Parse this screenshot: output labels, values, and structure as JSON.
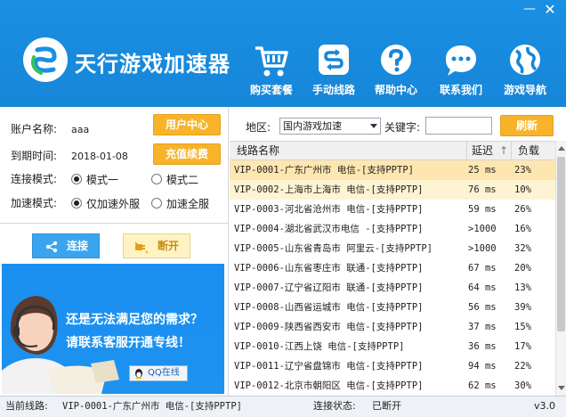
{
  "app": {
    "title": "天行游戏加速器",
    "window_controls": {
      "minimize": "—",
      "close": "✕"
    }
  },
  "nav": [
    {
      "label": "购买套餐",
      "icon": "shopping-cart-icon"
    },
    {
      "label": "手动线路",
      "icon": "route-icon"
    },
    {
      "label": "帮助中心",
      "icon": "help-icon"
    },
    {
      "label": "联系我们",
      "icon": "chat-icon"
    },
    {
      "label": "游戏导航",
      "icon": "globe-icon"
    }
  ],
  "account": {
    "username_label": "账户名称:",
    "username": "aaa",
    "expiry_label": "到期时间:",
    "expiry": "2018-01-08",
    "user_center_btn": "用户中心",
    "recharge_btn": "充值续费"
  },
  "modes": {
    "connect_label": "连接模式:",
    "connect_options": [
      "模式一",
      "模式二"
    ],
    "connect_selected": 0,
    "accel_label": "加速模式:",
    "accel_options": [
      "仅加速外服",
      "加速全服"
    ],
    "accel_selected": 0
  },
  "actions": {
    "connect": "连接",
    "disconnect": "断开"
  },
  "banner": {
    "line1": "还是无法满足您的需求？",
    "line2": "请联系客服开通专线！",
    "qq_button": "QQ在线"
  },
  "filter": {
    "region_label": "地区:",
    "region_value": "国内游戏加速",
    "keyword_label": "关键字:",
    "keyword_value": "",
    "refresh_btn": "刷新"
  },
  "table": {
    "columns": [
      "线路名称",
      "延迟",
      "负载"
    ],
    "sort_indicator": "↑",
    "rows": [
      {
        "name": "VIP-0001-广东广州市   电信-[支持PPTP]",
        "ping": "25  ms",
        "load": "23%"
      },
      {
        "name": "VIP-0002-上海市上海市 电信-[支持PPTP]",
        "ping": "76  ms",
        "load": "10%"
      },
      {
        "name": "VIP-0003-河北省沧州市 电信-[支持PPTP]",
        "ping": "59  ms",
        "load": "26%"
      },
      {
        "name": "VIP-0004-湖北省武汉市电信 -[支持PPTP]",
        "ping": ">1000",
        "load": "16%"
      },
      {
        "name": "VIP-0005-山东省青岛市  阿里云-[支持PPTP]",
        "ping": ">1000",
        "load": "32%"
      },
      {
        "name": "VIP-0006-山东省枣庄市 联通-[支持PPTP]",
        "ping": "67  ms",
        "load": "20%"
      },
      {
        "name": "VIP-0007-辽宁省辽阳市 联通-[支持PPTP]",
        "ping": "64  ms",
        "load": "13%"
      },
      {
        "name": "VIP-0008-山西省运城市 电信-[支持PPTP]",
        "ping": "56  ms",
        "load": "39%"
      },
      {
        "name": "VIP-0009-陕西省西安市 电信-[支持PPTP]",
        "ping": "37  ms",
        "load": "15%"
      },
      {
        "name": "VIP-0010-江西上饶     电信-[支持PPTP]",
        "ping": "36  ms",
        "load": "17%"
      },
      {
        "name": "VIP-0011-辽宁省盘锦市 电信-[支持PPTP]",
        "ping": "94  ms",
        "load": "22%"
      },
      {
        "name": "VIP-0012-北京市朝阳区 电信-[支持PPTP]",
        "ping": "62  ms",
        "load": "30%"
      }
    ]
  },
  "status": {
    "line_label": "当前线路:",
    "line_value": "VIP-0001-广东广州市   电信-[支持PPTP]",
    "conn_label": "连接状态:",
    "conn_value": "已断开",
    "version": "v3.0"
  },
  "colors": {
    "header_blue": "#1686d8",
    "accent_orange": "#f7b42a",
    "selected_row": "#fde6b0"
  }
}
